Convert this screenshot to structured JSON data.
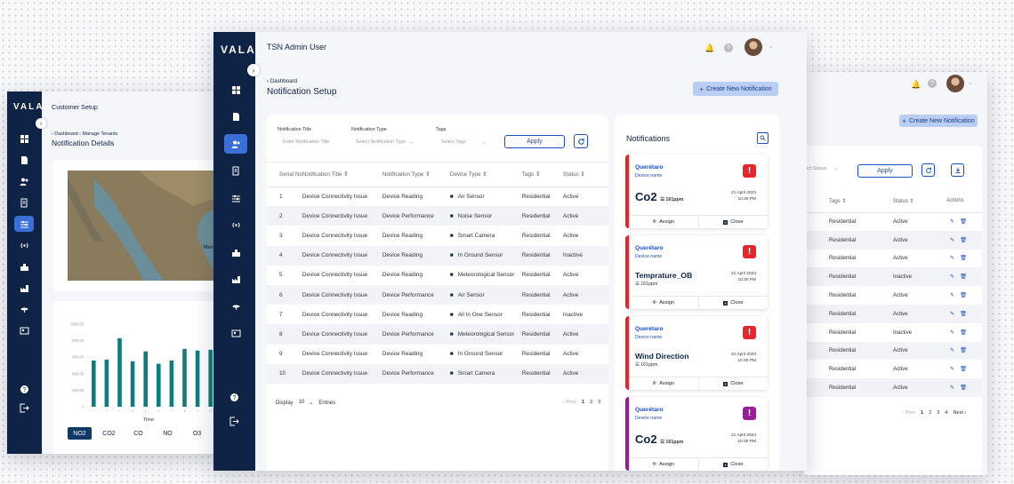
{
  "brand": "VALA",
  "left_window": {
    "title": "Customer Setup",
    "breadcrumb": [
      "Dashboard",
      "Manage Tenants"
    ],
    "page_title": "Notification Details",
    "map_label": "Mexic",
    "chart_data": {
      "type": "bar",
      "categories": [
        "1",
        "2",
        "3",
        "4",
        "5",
        "6",
        "7",
        "8",
        "9",
        "10"
      ],
      "values": [
        560,
        570,
        830,
        550,
        670,
        520,
        560,
        700,
        680,
        690
      ],
      "title": "",
      "xlabel": "Time",
      "ylabel": "",
      "ylim": [
        0,
        1000
      ],
      "yticks": [
        "1000.00",
        "800.00",
        "600.00",
        "400.00",
        "200.00",
        "0"
      ],
      "bar_color": "#0d7d80"
    },
    "gas_tabs": [
      {
        "label": "NO2",
        "active": true
      },
      {
        "label": "CO2",
        "active": false
      },
      {
        "label": "CO",
        "active": false
      },
      {
        "label": "NO",
        "active": false
      },
      {
        "label": "O3",
        "active": false
      }
    ]
  },
  "main_window": {
    "header_title": "TSN Admin User",
    "breadcrumb": "Dashboard",
    "page_title": "Notification Setup",
    "create_button": "Create New Notification",
    "filters": {
      "title_label": "Notification Title",
      "title_placeholder": "Enter Notification Title",
      "type_label": "Notification Type",
      "type_placeholder": "Select Notification Type",
      "tags_label": "Tags",
      "tags_placeholder": "Select Tags",
      "apply": "Apply"
    },
    "columns": [
      "Serial No",
      "Notification Title",
      "Notification Type",
      "Device Type",
      "Tags",
      "Status"
    ],
    "rows": [
      {
        "sn": "1",
        "title": "Device Connectivity Issue",
        "type": "Device Reading",
        "device": "Air Sensor",
        "tag": "Residential",
        "status": "Active"
      },
      {
        "sn": "2",
        "title": "Device Connectivity Issue",
        "type": "Device Performance",
        "device": "Noise Sensor",
        "tag": "Residential",
        "status": "Active"
      },
      {
        "sn": "3",
        "title": "Device Connectivity Issue",
        "type": "Device Reading",
        "device": "Smart Camera",
        "tag": "Residential",
        "status": "Active"
      },
      {
        "sn": "4",
        "title": "Device Connectivity Issue",
        "type": "Device Reading",
        "device": "In Ground Sensor",
        "tag": "Residential",
        "status": "Inactive"
      },
      {
        "sn": "5",
        "title": "Device Connectivity Issue",
        "type": "Device Reading",
        "device": "Meteorological Sensor",
        "tag": "Residential",
        "status": "Active"
      },
      {
        "sn": "6",
        "title": "Device Connectivity Issue",
        "type": "Device Performance",
        "device": "Air Sensor",
        "tag": "Residential",
        "status": "Active"
      },
      {
        "sn": "7",
        "title": "Device Connectivity Issue",
        "type": "Device Reading",
        "device": "All In One Sensor",
        "tag": "Residential",
        "status": "Inactive"
      },
      {
        "sn": "8",
        "title": "Device Connectivity Issue",
        "type": "Device Performance",
        "device": "Meteorological Sensor",
        "tag": "Residential",
        "status": "Active"
      },
      {
        "sn": "9",
        "title": "Device Connectivity Issue",
        "type": "Device Reading",
        "device": "In Ground Sensor",
        "tag": "Residential",
        "status": "Active"
      },
      {
        "sn": "10",
        "title": "Device Connectivity Issue",
        "type": "Device Performance",
        "device": "Smart Camera",
        "tag": "Residential",
        "status": "Active"
      }
    ],
    "display_label": "Display",
    "display_value": "10",
    "entries_label": "Entries",
    "pagination": {
      "prev": "Prev",
      "pages": [
        "1",
        "2",
        "3"
      ]
    },
    "notifications_title": "Notifications",
    "notifications": [
      {
        "city": "Querétaro",
        "device": "Device name",
        "metric": "Co2",
        "ppm": "161ppm",
        "date": "21 April 2023",
        "time": "10:30 PM",
        "color": "#e8252a",
        "alert": "!"
      },
      {
        "city": "Querétaro",
        "device": "Device name",
        "metric": "Temprature_OB",
        "ppm": "161ppm",
        "date": "21 April 2023",
        "time": "10:30 PM",
        "color": "#e8252a",
        "alert": "!"
      },
      {
        "city": "Querétaro",
        "device": "Device name",
        "metric": "Wind Direction",
        "ppm": "161ppm",
        "date": "21 April 2023",
        "time": "10:30 PM",
        "color": "#e8252a",
        "alert": "!"
      },
      {
        "city": "Querétaro",
        "device": "Device name",
        "metric": "Co2",
        "ppm": "161ppm",
        "date": "21 April 2023",
        "time": "10:30 PM",
        "color": "#9b1c9b",
        "alert": "!"
      }
    ],
    "assign_label": "Assign",
    "close_label": "Close"
  },
  "right_window": {
    "create_button": "Create New Notification",
    "status_placeholder": "lect Status",
    "apply": "Apply",
    "columns": [
      "Tags",
      "Status",
      "Actions"
    ],
    "rows": [
      {
        "tag": "Residential",
        "status": "Active"
      },
      {
        "tag": "Residential",
        "status": "Active"
      },
      {
        "tag": "Residential",
        "status": "Active"
      },
      {
        "tag": "Residential",
        "status": "Inactive"
      },
      {
        "tag": "Residential",
        "status": "Active"
      },
      {
        "tag": "Residential",
        "status": "Active"
      },
      {
        "tag": "Residential",
        "status": "Inactive"
      },
      {
        "tag": "Residential",
        "status": "Active"
      },
      {
        "tag": "Residential",
        "status": "Active"
      },
      {
        "tag": "Residential",
        "status": "Active"
      }
    ],
    "pagination": {
      "prev": "Prev",
      "pages": [
        "1",
        "2",
        "3",
        "4"
      ],
      "next": "Next"
    }
  }
}
